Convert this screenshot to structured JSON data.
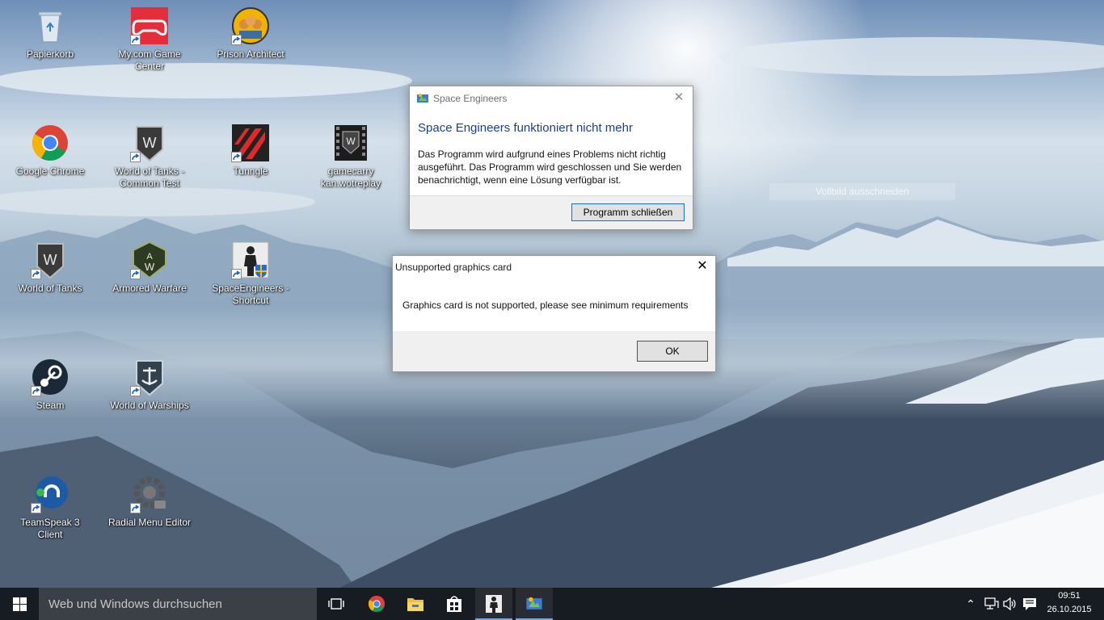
{
  "desktop": {
    "icons": [
      {
        "id": "recycle",
        "label": "Papierkorb",
        "icon": "recycle-bin-icon"
      },
      {
        "id": "mygame",
        "label": "My.com Game Center",
        "icon": "gamepad-icon"
      },
      {
        "id": "prison",
        "label": "Prison Architect",
        "icon": "prison-architect-icon"
      },
      {
        "id": "chrome",
        "label": "Google Chrome",
        "icon": "chrome-icon"
      },
      {
        "id": "wot-common",
        "label": "World of Tanks - Common Test",
        "icon": "world-of-tanks-icon"
      },
      {
        "id": "tunngle",
        "label": "Tunngle",
        "icon": "tunngle-icon"
      },
      {
        "id": "gamecarry",
        "label": "gamecarry kan.wotreplay",
        "icon": "wotreplay-file-icon"
      },
      {
        "id": "wot",
        "label": "World of Tanks",
        "icon": "world-of-tanks-icon"
      },
      {
        "id": "armored",
        "label": "Armored Warfare",
        "icon": "armored-warfare-icon"
      },
      {
        "id": "se-shortcut",
        "label": "SpaceEngineers - Shortcut",
        "icon": "space-engineers-icon"
      },
      {
        "id": "steam",
        "label": "Steam",
        "icon": "steam-icon"
      },
      {
        "id": "wows",
        "label": "World of Warships",
        "icon": "world-of-warships-icon"
      },
      {
        "id": "ts3",
        "label": "TeamSpeak 3 Client",
        "icon": "teamspeak-icon"
      },
      {
        "id": "radial",
        "label": "Radial Menu Editor",
        "icon": "radial-menu-icon"
      }
    ],
    "ghost_text": "Vollbild ausschneiden"
  },
  "dialog_se": {
    "title": "Space Engineers",
    "heading": "Space Engineers funktioniert nicht mehr",
    "body": "Das Programm wird aufgrund eines Problems nicht richtig ausgeführt. Das Programm wird geschlossen und Sie werden benachrichtigt, wenn eine Lösung verfügbar ist.",
    "button": "Programm schließen",
    "heading_color": "#1c3f94"
  },
  "dialog_gfx": {
    "title": "Unsupported graphics card",
    "message": "Graphics card is not supported, please see minimum requirements",
    "button": "OK"
  },
  "taskbar": {
    "search_placeholder": "Web und Windows durchsuchen",
    "pinned": [
      "task-view-icon",
      "chrome-icon",
      "file-explorer-icon",
      "store-icon",
      "space-engineers-icon",
      "space-engineers-crash-icon"
    ],
    "tray_icons": [
      "chevron-up-icon",
      "network-icon",
      "volume-icon",
      "action-center-icon"
    ],
    "time": "09:51",
    "date": "26.10.2015"
  }
}
